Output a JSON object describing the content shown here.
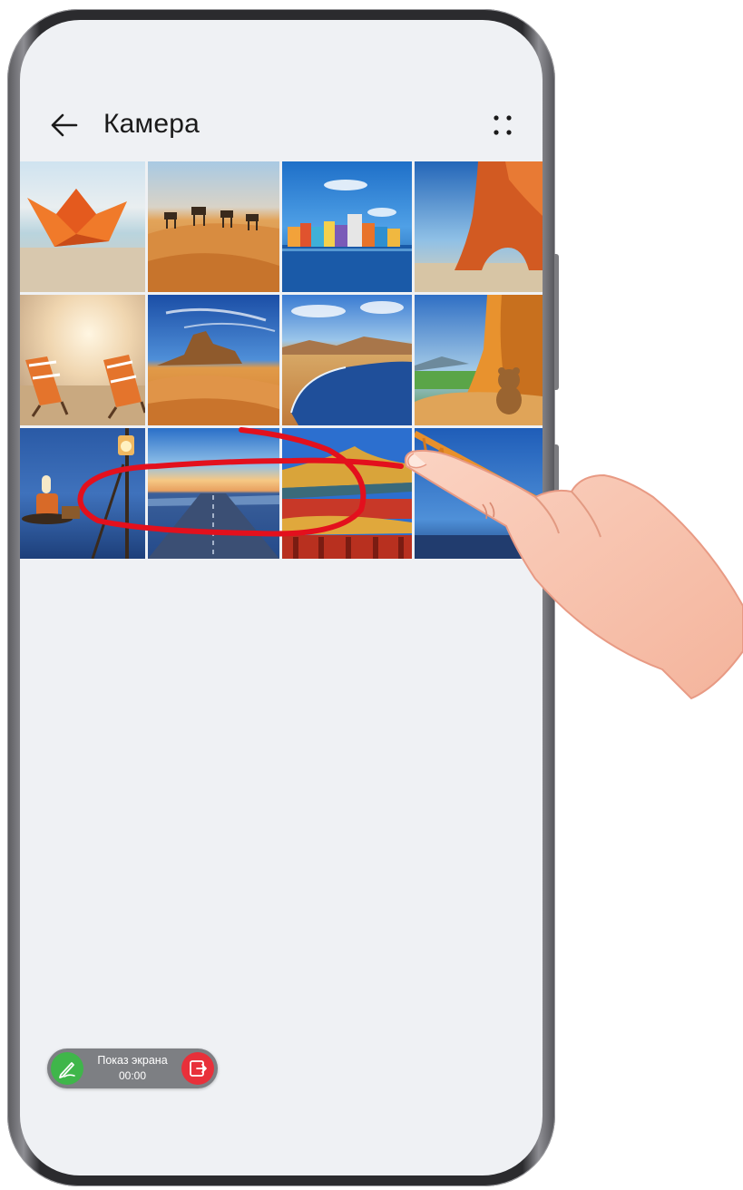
{
  "header": {
    "title": "Камера",
    "back_icon": "arrow-left-icon",
    "more_icon": "more-dots-icon"
  },
  "gallery": {
    "thumbnails": [
      {
        "subject": "paper boat on beach"
      },
      {
        "subject": "camel caravan in desert"
      },
      {
        "subject": "colorful houses on water"
      },
      {
        "subject": "red rock arch by the sea"
      },
      {
        "subject": "beach chairs at sunset"
      },
      {
        "subject": "desert rock formation"
      },
      {
        "subject": "lake in desert valley"
      },
      {
        "subject": "teddy bear in tent"
      },
      {
        "subject": "lantern by the sea at dusk"
      },
      {
        "subject": "road at sunset"
      },
      {
        "subject": "chinese pavilion roof"
      },
      {
        "subject": "orange steel bridge"
      }
    ]
  },
  "annotation": {
    "color": "#e3101d"
  },
  "screen_share": {
    "label": "Показ экрана",
    "timer": "00:00",
    "pen_icon": "pen-icon",
    "stop_icon": "exit-share-icon",
    "pen_color": "#3fb64a",
    "stop_color": "#e8303a"
  }
}
